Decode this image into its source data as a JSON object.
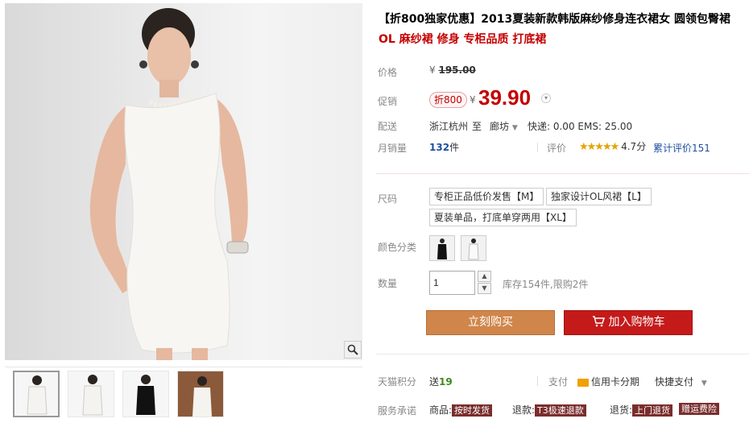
{
  "product": {
    "title": "【折800独家优惠】2013夏装新款韩版麻纱修身连衣裙女 圆领包臀裙",
    "subtitle": "OL 麻纱裙 修身 专柜品质 打底裙"
  },
  "price": {
    "label": "价格",
    "currency": "¥",
    "original": "195.00"
  },
  "promo": {
    "label": "促销",
    "badge": "折800",
    "currency": "¥",
    "price": "39.90"
  },
  "shipping": {
    "label": "配送",
    "from": "浙江杭州",
    "to_word": "至",
    "to": "廊坊",
    "fees": "快递: 0.00 EMS: 25.00"
  },
  "stats": {
    "sales_label": "月销量",
    "sales_count": "132",
    "sales_unit": "件",
    "rating_label": "评价",
    "stars": "★★★★★",
    "rating": "4.7分",
    "reviews": "累计评价151"
  },
  "size": {
    "label": "尺码",
    "options": [
      "专柜正品低价发售【M】",
      "独家设计OL风裙【L】",
      "夏装单品，打底单穿两用【XL】"
    ]
  },
  "color": {
    "label": "颜色分类",
    "swatches": [
      "black",
      "white"
    ]
  },
  "quantity": {
    "label": "数量",
    "value": "1",
    "stock": "库存154件,限购2件"
  },
  "actions": {
    "buy_now": "立刻购买",
    "add_to_cart": "加入购物车"
  },
  "points": {
    "label": "天猫积分",
    "send": "送",
    "value": "19",
    "pay_label": "支付",
    "credit": "信用卡分期",
    "quick_pay": "快捷支付"
  },
  "service": {
    "label": "服务承诺",
    "goods": "商品:",
    "goods_tag": "按时发货",
    "refund": "退款:",
    "refund_tag": "T3极速退款",
    "return": "退货:",
    "return_tag": "上门退货",
    "freight_tag": "赠运费险"
  },
  "colors": {
    "accent_red": "#c40000",
    "buy_orange": "#d0864a",
    "cart_red": "#c41a1a"
  }
}
